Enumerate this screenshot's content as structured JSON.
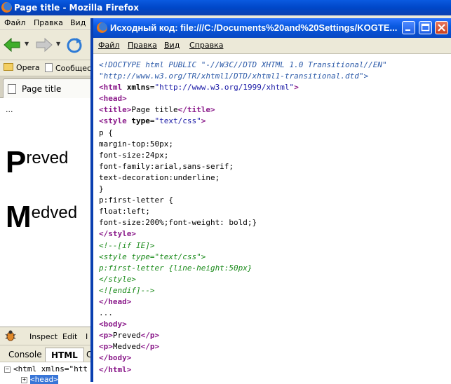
{
  "firefox": {
    "window_title": "Page title - Mozilla Firefox",
    "menu": [
      "Файл",
      "Правка",
      "Вид"
    ],
    "bookmarks": [
      "Opera",
      "Сообщес"
    ],
    "tab_title": "Page title",
    "page": {
      "dots": "...",
      "paragraphs": [
        {
          "first": "P",
          "rest": "reved"
        },
        {
          "first": "M",
          "rest": "edved"
        }
      ]
    },
    "firebug": {
      "toolbar": [
        "Inspect",
        "Edit",
        "I"
      ],
      "tabs": [
        "Console",
        "HTML",
        "C"
      ],
      "active_tab": "HTML",
      "tree": [
        {
          "expander": "−",
          "text": "<html xmlns=\"htt"
        },
        {
          "expander": "+",
          "text": "<head>"
        }
      ]
    }
  },
  "view_source": {
    "title": "Исходный код: file:///C:/Documents%20and%20Settings/KOGTE...",
    "menu": [
      "Файл",
      "Правка",
      "Вид",
      "Справка"
    ],
    "lines": [
      [
        {
          "c": "doctype",
          "t": "<!DOCTYPE html PUBLIC \"-//W3C//DTD XHTML 1.0 Transitional//EN\""
        }
      ],
      [
        {
          "c": "doctype",
          "t": "\"http://www.w3.org/TR/xhtml1/DTD/xhtml1-transitional.dtd\">"
        }
      ],
      [
        {
          "c": "tag",
          "t": "<html"
        },
        {
          "c": "attr",
          "t": " xmlns"
        },
        {
          "c": "text",
          "t": "="
        },
        {
          "c": "val",
          "t": "\"http://www.w3.org/1999/xhtml\""
        },
        {
          "c": "tag",
          "t": ">"
        }
      ],
      [
        {
          "c": "tag",
          "t": "<head>"
        }
      ],
      [
        {
          "c": "tag",
          "t": "<title>"
        },
        {
          "c": "text",
          "t": "Page title"
        },
        {
          "c": "tag",
          "t": "</title>"
        }
      ],
      [
        {
          "c": "tag",
          "t": "<style"
        },
        {
          "c": "attr",
          "t": " type"
        },
        {
          "c": "text",
          "t": "="
        },
        {
          "c": "val",
          "t": "\"text/css\""
        },
        {
          "c": "tag",
          "t": ">"
        }
      ],
      [
        {
          "c": "text",
          "t": "p {"
        }
      ],
      [
        {
          "c": "text",
          "t": "margin-top:50px;"
        }
      ],
      [
        {
          "c": "text",
          "t": "font-size:24px;"
        }
      ],
      [
        {
          "c": "text",
          "t": "font-family:arial,sans-serif;"
        }
      ],
      [
        {
          "c": "text",
          "t": "text-decoration:underline;"
        }
      ],
      [
        {
          "c": "text",
          "t": "}"
        }
      ],
      [
        {
          "c": "text",
          "t": "p:first-letter {"
        }
      ],
      [
        {
          "c": "text",
          "t": "float:left;"
        }
      ],
      [
        {
          "c": "text",
          "t": "font-size:200%;font-weight: bold;}"
        }
      ],
      [
        {
          "c": "tag",
          "t": "</style>"
        }
      ],
      [
        {
          "c": "comment",
          "t": "<!--[if IE]>"
        }
      ],
      [
        {
          "c": "comment",
          "t": "<style type=\"text/css\">"
        }
      ],
      [
        {
          "c": "comment",
          "t": "p:first-letter {line-height:50px}"
        }
      ],
      [
        {
          "c": "comment",
          "t": "</style>"
        }
      ],
      [
        {
          "c": "comment",
          "t": "<![endif]-->"
        }
      ],
      [
        {
          "c": "tag",
          "t": "</head>"
        }
      ],
      [
        {
          "c": "text",
          "t": "..."
        }
      ],
      [
        {
          "c": "tag",
          "t": "<body>"
        }
      ],
      [
        {
          "c": "tag",
          "t": "<p>"
        },
        {
          "c": "text",
          "t": "Preved"
        },
        {
          "c": "tag",
          "t": "</p>"
        }
      ],
      [
        {
          "c": "tag",
          "t": "<p>"
        },
        {
          "c": "text",
          "t": "Medved"
        },
        {
          "c": "tag",
          "t": "</p>"
        }
      ],
      [
        {
          "c": "tag",
          "t": "</body>"
        }
      ],
      [
        {
          "c": "tag",
          "t": "</html>"
        }
      ]
    ]
  }
}
